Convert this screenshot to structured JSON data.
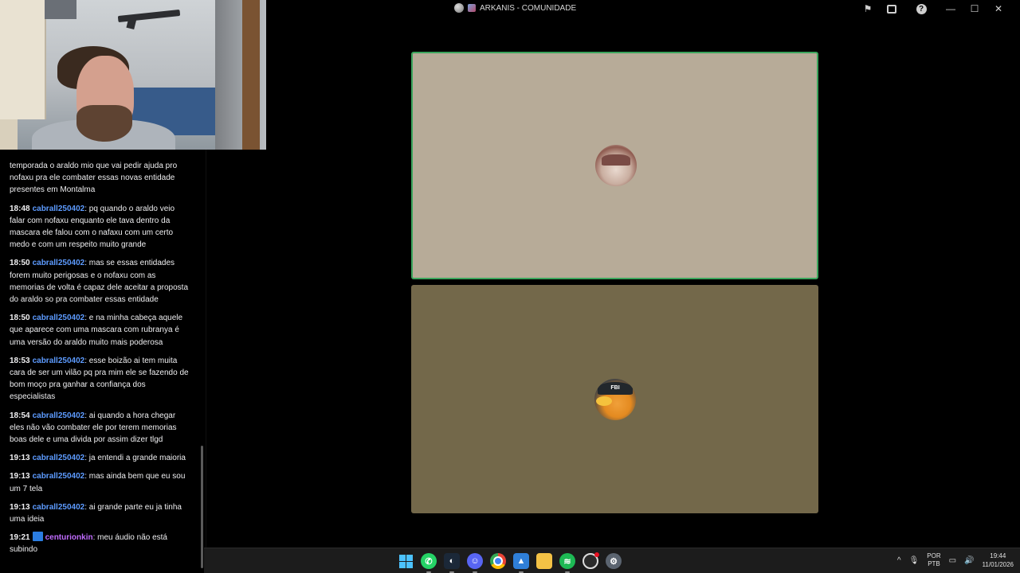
{
  "window": {
    "title": "ARKANIS - COMUNIDADE",
    "icons": [
      "globe-icon",
      "server-icon",
      "flag-icon",
      "inbox-icon",
      "help-icon",
      "minimize-icon",
      "maximize-icon",
      "close-icon"
    ]
  },
  "titlebar_glyphs": {
    "flag": "⚑",
    "help": "?",
    "minimize": "—",
    "maximize": "☐",
    "close": "✕"
  },
  "chat": {
    "messages": [
      {
        "time": "",
        "user": "",
        "text": "temporada o araldo mio que vai pedir ajuda pro nofaxu pra ele combater essas novas entidade presentes em Montalma"
      },
      {
        "time": "18:48",
        "user": "cabrall250402",
        "text": ": pq quando o araldo veio falar com nofaxu enquanto ele tava dentro da mascara ele falou com o nafaxu com um certo medo e com um respeito muito grande"
      },
      {
        "time": "18:50",
        "user": "cabrall250402",
        "text": ": mas se essas entidades forem muito perigosas e o nofaxu com as memorias de volta é capaz dele aceitar a proposta do araldo so pra combater essas entidade"
      },
      {
        "time": "18:50",
        "user": "cabrall250402",
        "text": ": e na minha cabeça aquele que aparece com uma mascara com rubranya é uma versão do araldo muito mais poderosa"
      },
      {
        "time": "18:53",
        "user": "cabrall250402",
        "text": ": esse boizão ai tem muita cara de ser um vilão pq pra mim ele se fazendo de bom moço pra ganhar a confiança dos especialistas"
      },
      {
        "time": "18:54",
        "user": "cabrall250402",
        "text": ": ai quando a hora chegar eles não vão combater ele por terem memorias boas dele e uma divida por assim dizer tlgd"
      },
      {
        "time": "19:13",
        "user": "cabrall250402",
        "text": ": ja entendi a grande maioria"
      },
      {
        "time": "19:13",
        "user": "cabrall250402",
        "text": ": mas ainda bem que eu sou um 7 tela"
      },
      {
        "time": "19:13",
        "user": "cabrall250402",
        "text": ": ai grande parte eu ja tinha uma ideia"
      },
      {
        "time": "19:21",
        "user": "centurionkin",
        "text": ": meu áudio não está subindo"
      }
    ]
  },
  "call": {
    "tiles": [
      {
        "speaking": true,
        "bg": "#b7ab98",
        "border": "#3ba55c"
      },
      {
        "speaking": false,
        "bg": "#73684a"
      }
    ],
    "avatar2_cap_text": "FBI"
  },
  "taskbar": {
    "apps": [
      "windows-start-icon",
      "whatsapp-icon",
      "steam-icon",
      "discord-icon",
      "chrome-icon",
      "photos-icon",
      "file-explorer-icon",
      "spotify-icon",
      "obs-icon",
      "settings-icon"
    ],
    "tray": {
      "chevron": "^",
      "lang_top": "POR",
      "lang_bottom": "PTB",
      "time": "19:44",
      "date": "11/01/2026"
    }
  }
}
